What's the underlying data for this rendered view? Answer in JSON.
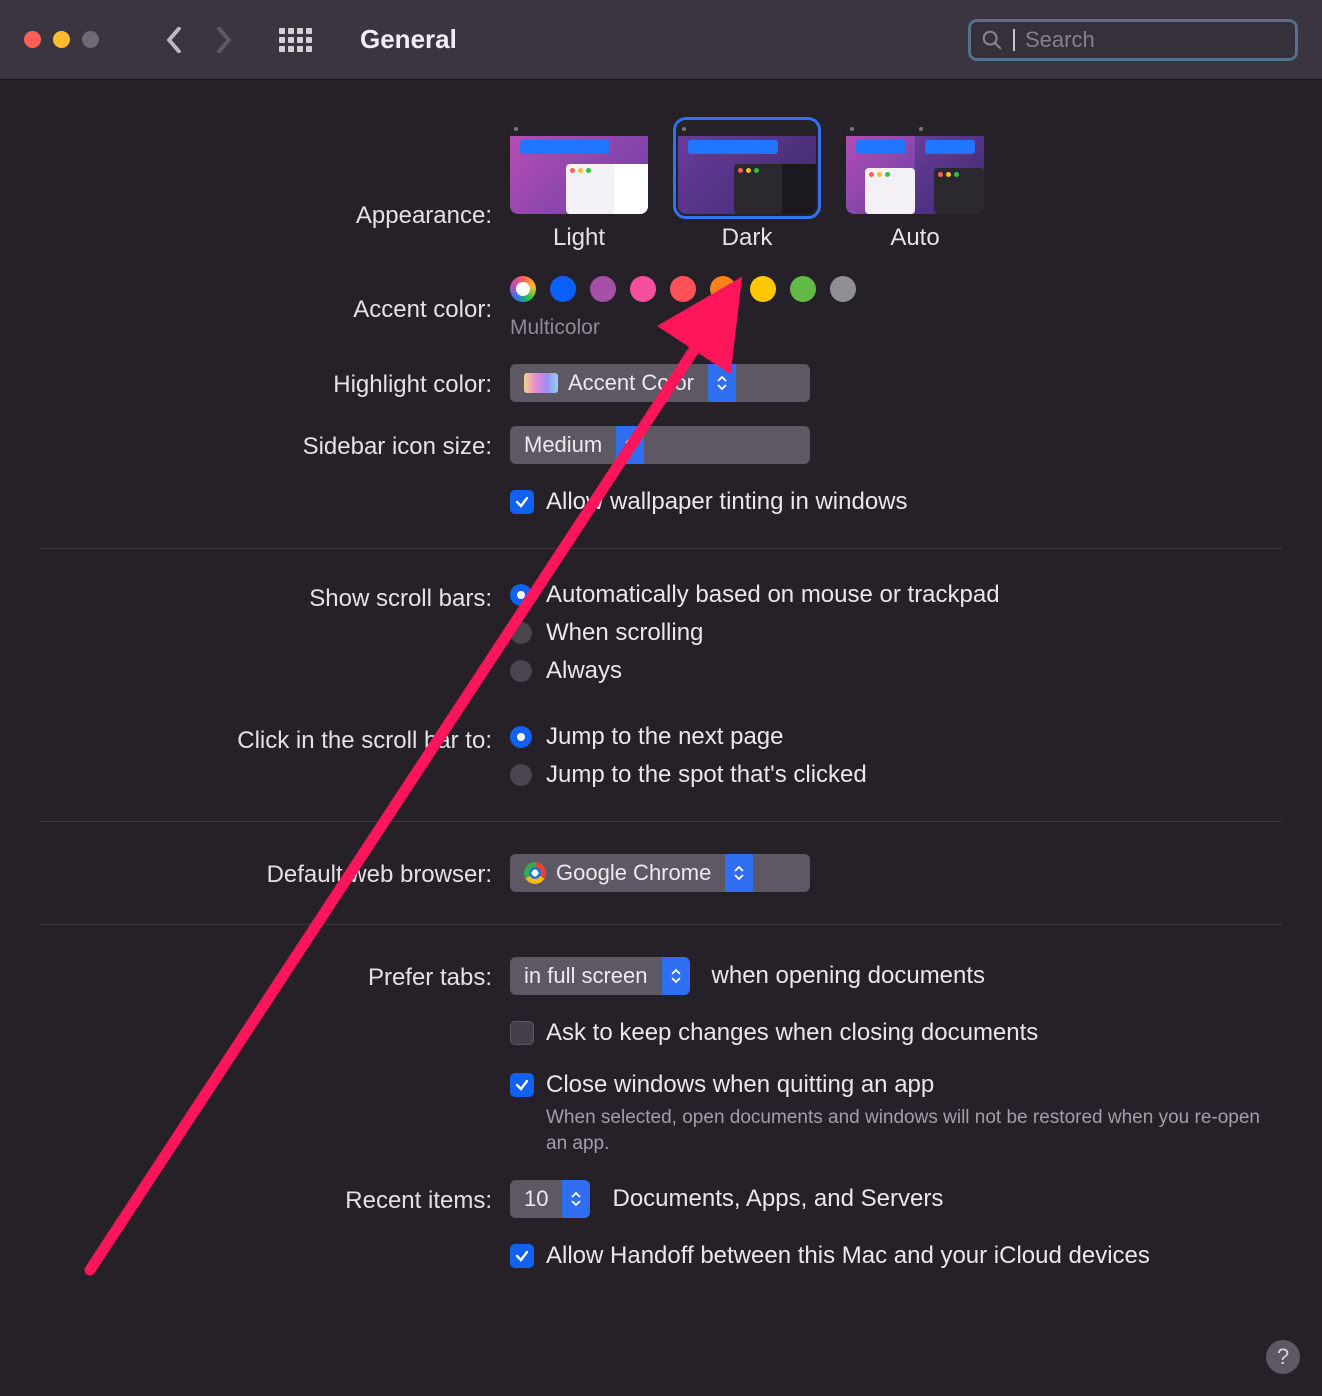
{
  "toolbar": {
    "title": "General",
    "search_placeholder": "Search"
  },
  "appearance": {
    "label": "Appearance:",
    "options": [
      {
        "key": "light",
        "label": "Light"
      },
      {
        "key": "dark",
        "label": "Dark"
      },
      {
        "key": "auto",
        "label": "Auto"
      }
    ],
    "selected": "dark"
  },
  "accent": {
    "label": "Accent color:",
    "sub": "Multicolor",
    "colors": [
      {
        "key": "multicolor",
        "hex": ""
      },
      {
        "key": "blue",
        "hex": "#0a60ff"
      },
      {
        "key": "purple",
        "hex": "#a550a7"
      },
      {
        "key": "pink",
        "hex": "#f74f9e"
      },
      {
        "key": "red",
        "hex": "#ff5257"
      },
      {
        "key": "orange",
        "hex": "#f7821b"
      },
      {
        "key": "yellow",
        "hex": "#ffc700"
      },
      {
        "key": "green",
        "hex": "#62ba46"
      },
      {
        "key": "gray",
        "hex": "#8e8e93"
      }
    ],
    "selected": "multicolor"
  },
  "highlight": {
    "label": "Highlight color:",
    "value": "Accent Color"
  },
  "sidebar_size": {
    "label": "Sidebar icon size:",
    "value": "Medium"
  },
  "wallpaper_tint": {
    "label": "Allow wallpaper tinting in windows",
    "checked": true
  },
  "scrollbars": {
    "label": "Show scroll bars:",
    "options": [
      "Automatically based on mouse or trackpad",
      "When scrolling",
      "Always"
    ],
    "selected": 0
  },
  "click_scroll": {
    "label": "Click in the scroll bar to:",
    "options": [
      "Jump to the next page",
      "Jump to the spot that's clicked"
    ],
    "selected": 0
  },
  "browser": {
    "label": "Default web browser:",
    "value": "Google Chrome"
  },
  "tabs": {
    "label": "Prefer tabs:",
    "value": "in full screen",
    "suffix": "when opening documents"
  },
  "ask_keep": {
    "label": "Ask to keep changes when closing documents",
    "checked": false
  },
  "close_windows": {
    "label": "Close windows when quitting an app",
    "sub": "When selected, open documents and windows will not be restored when you re-open an app.",
    "checked": true
  },
  "recent": {
    "label": "Recent items:",
    "value": "10",
    "suffix": "Documents, Apps, and Servers"
  },
  "handoff": {
    "label": "Allow Handoff between this Mac and your iCloud devices",
    "checked": true
  },
  "help": "?"
}
